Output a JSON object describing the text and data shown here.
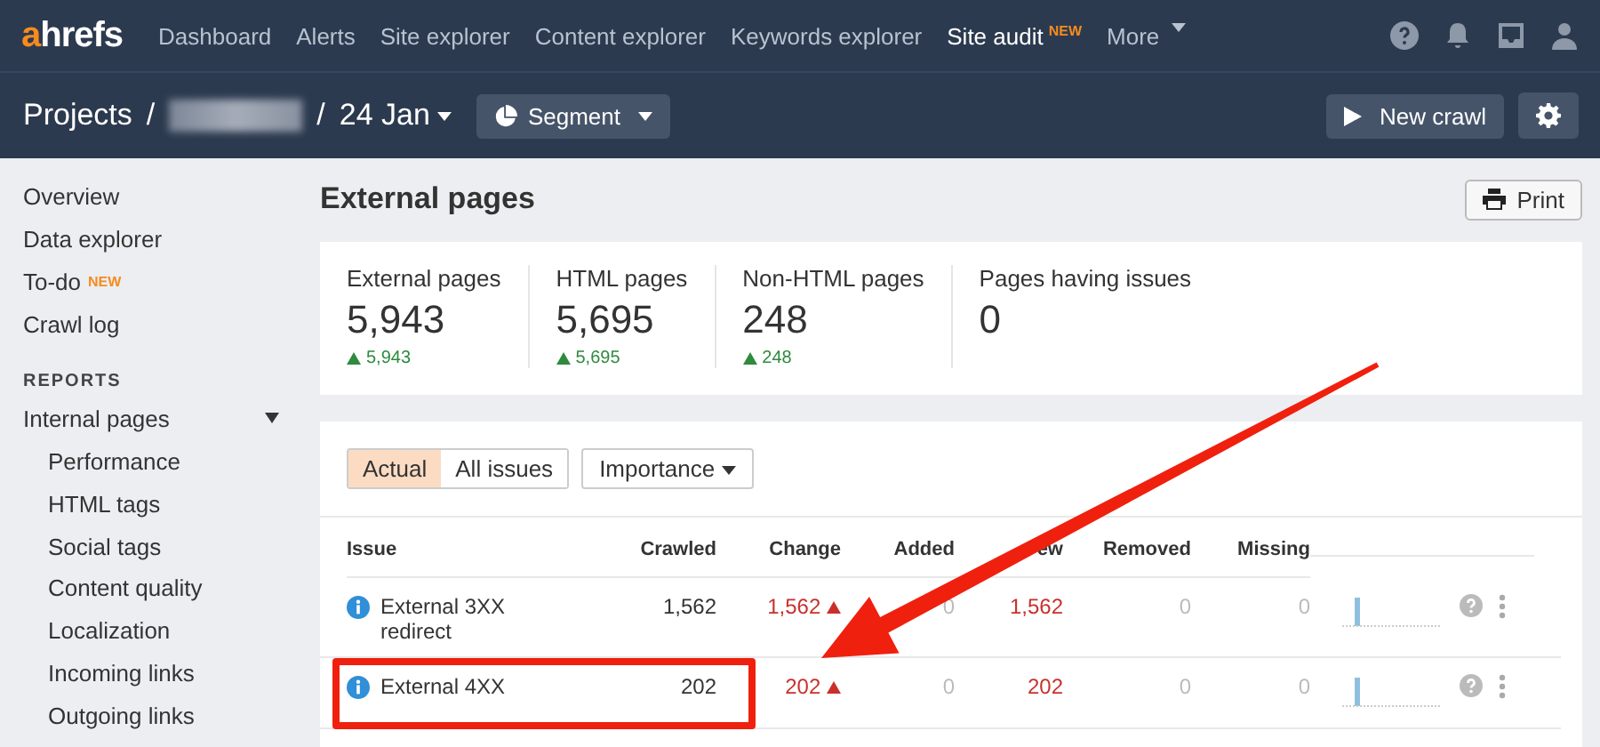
{
  "nav": {
    "logo": {
      "first": "a",
      "rest": "hrefs"
    },
    "items": [
      {
        "label": "Dashboard",
        "selected": false
      },
      {
        "label": "Alerts",
        "selected": false
      },
      {
        "label": "Site explorer",
        "selected": false
      },
      {
        "label": "Content explorer",
        "selected": false
      },
      {
        "label": "Keywords explorer",
        "selected": false
      },
      {
        "label": "Site audit",
        "selected": true,
        "badge": "NEW"
      }
    ],
    "more": "More"
  },
  "breadcrumb": {
    "projects": "Projects",
    "sep1": "/",
    "sep2": "/",
    "date": "24 Jan",
    "segment": "Segment"
  },
  "actions": {
    "new_crawl": "New crawl"
  },
  "sidebar": {
    "top": [
      {
        "label": "Overview"
      },
      {
        "label": "Data explorer"
      },
      {
        "label": "To-do",
        "badge": "NEW"
      },
      {
        "label": "Crawl log"
      }
    ],
    "section": "REPORTS",
    "groups": [
      {
        "label": "Internal pages",
        "expanded": true,
        "children": [
          {
            "label": "Performance"
          },
          {
            "label": "HTML tags"
          },
          {
            "label": "Social tags"
          },
          {
            "label": "Content quality"
          },
          {
            "label": "Localization"
          },
          {
            "label": "Incoming links"
          },
          {
            "label": "Outgoing links"
          }
        ]
      }
    ]
  },
  "page": {
    "title": "External pages",
    "print": "Print"
  },
  "stats": [
    {
      "label": "External pages",
      "value": "5,943",
      "delta": "5,943"
    },
    {
      "label": "HTML pages",
      "value": "5,695",
      "delta": "5,695"
    },
    {
      "label": "Non-HTML pages",
      "value": "248",
      "delta": "248"
    },
    {
      "label": "Pages having issues",
      "value": "0"
    }
  ],
  "filters": {
    "toggle": [
      {
        "label": "Actual",
        "selected": true
      },
      {
        "label": "All issues",
        "selected": false
      }
    ],
    "dropdown": "Importance"
  },
  "table": {
    "columns": [
      "Issue",
      "Crawled",
      "Change",
      "Added",
      "ew",
      "Removed",
      "Missing"
    ],
    "rows": [
      {
        "issue": "External 3XX redirect",
        "crawled": "1,562",
        "change": "1,562",
        "added": "0",
        "new": "1,562",
        "removed": "0",
        "missing": "0",
        "highlighted": false
      },
      {
        "issue": "External 4XX",
        "crawled": "202",
        "change": "202",
        "added": "0",
        "new": "202",
        "removed": "0",
        "missing": "0",
        "highlighted": true
      }
    ]
  }
}
